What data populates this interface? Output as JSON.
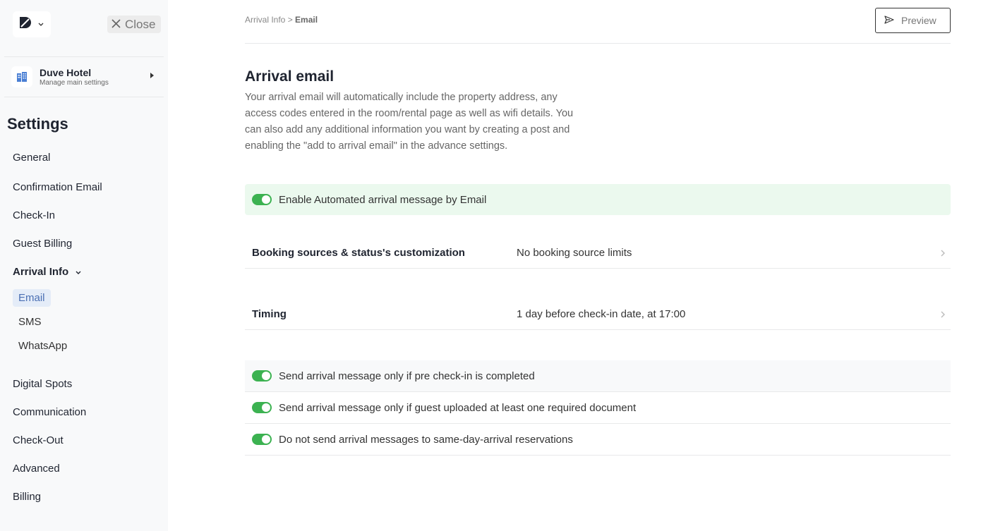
{
  "topbar": {
    "close_label": "Close",
    "preview_label": "Preview",
    "breadcrumb_parent": "Arrival Info",
    "breadcrumb_sep": " > ",
    "breadcrumb_current": "Email"
  },
  "property": {
    "name": "Duve Hotel",
    "subtitle": "Manage main settings"
  },
  "sidebar": {
    "title": "Settings",
    "items": [
      {
        "label": "General"
      },
      {
        "label": "Confirmation Email"
      },
      {
        "label": "Check-In"
      },
      {
        "label": "Guest Billing"
      },
      {
        "label": "Arrival Info"
      },
      {
        "label": "Digital Spots"
      },
      {
        "label": "Communication"
      },
      {
        "label": "Check-Out"
      },
      {
        "label": "Advanced"
      },
      {
        "label": "Billing"
      }
    ],
    "subitems": [
      {
        "label": "Email",
        "active": true
      },
      {
        "label": "SMS"
      },
      {
        "label": "WhatsApp"
      }
    ]
  },
  "main": {
    "title": "Arrival email",
    "description": "Your arrival email will automatically include the property address, any access codes entered in the room/rental page as well as wifi details. You can also add any additional information you want by creating a post and enabling the \"add to arrival email\" in the advance settings.",
    "enable_label": "Enable Automated arrival message by Email",
    "enable_on": true,
    "settings": [
      {
        "key": "Booking sources & status's customization",
        "value": "No booking source limits"
      },
      {
        "key": "Timing",
        "value": "1 day before check-in date, at 17:00"
      }
    ],
    "options": [
      {
        "label": "Send arrival message only if pre check-in is completed",
        "on": true
      },
      {
        "label": "Send arrival message only if guest uploaded at least one required document",
        "on": true
      },
      {
        "label": "Do not send arrival messages to same-day-arrival reservations",
        "on": true
      }
    ]
  },
  "colors": {
    "accent_green": "#3cb251",
    "banner_bg": "#ebf9ee",
    "active_nav_bg": "#e4ecf8",
    "active_nav_text": "#4a6fb3"
  }
}
